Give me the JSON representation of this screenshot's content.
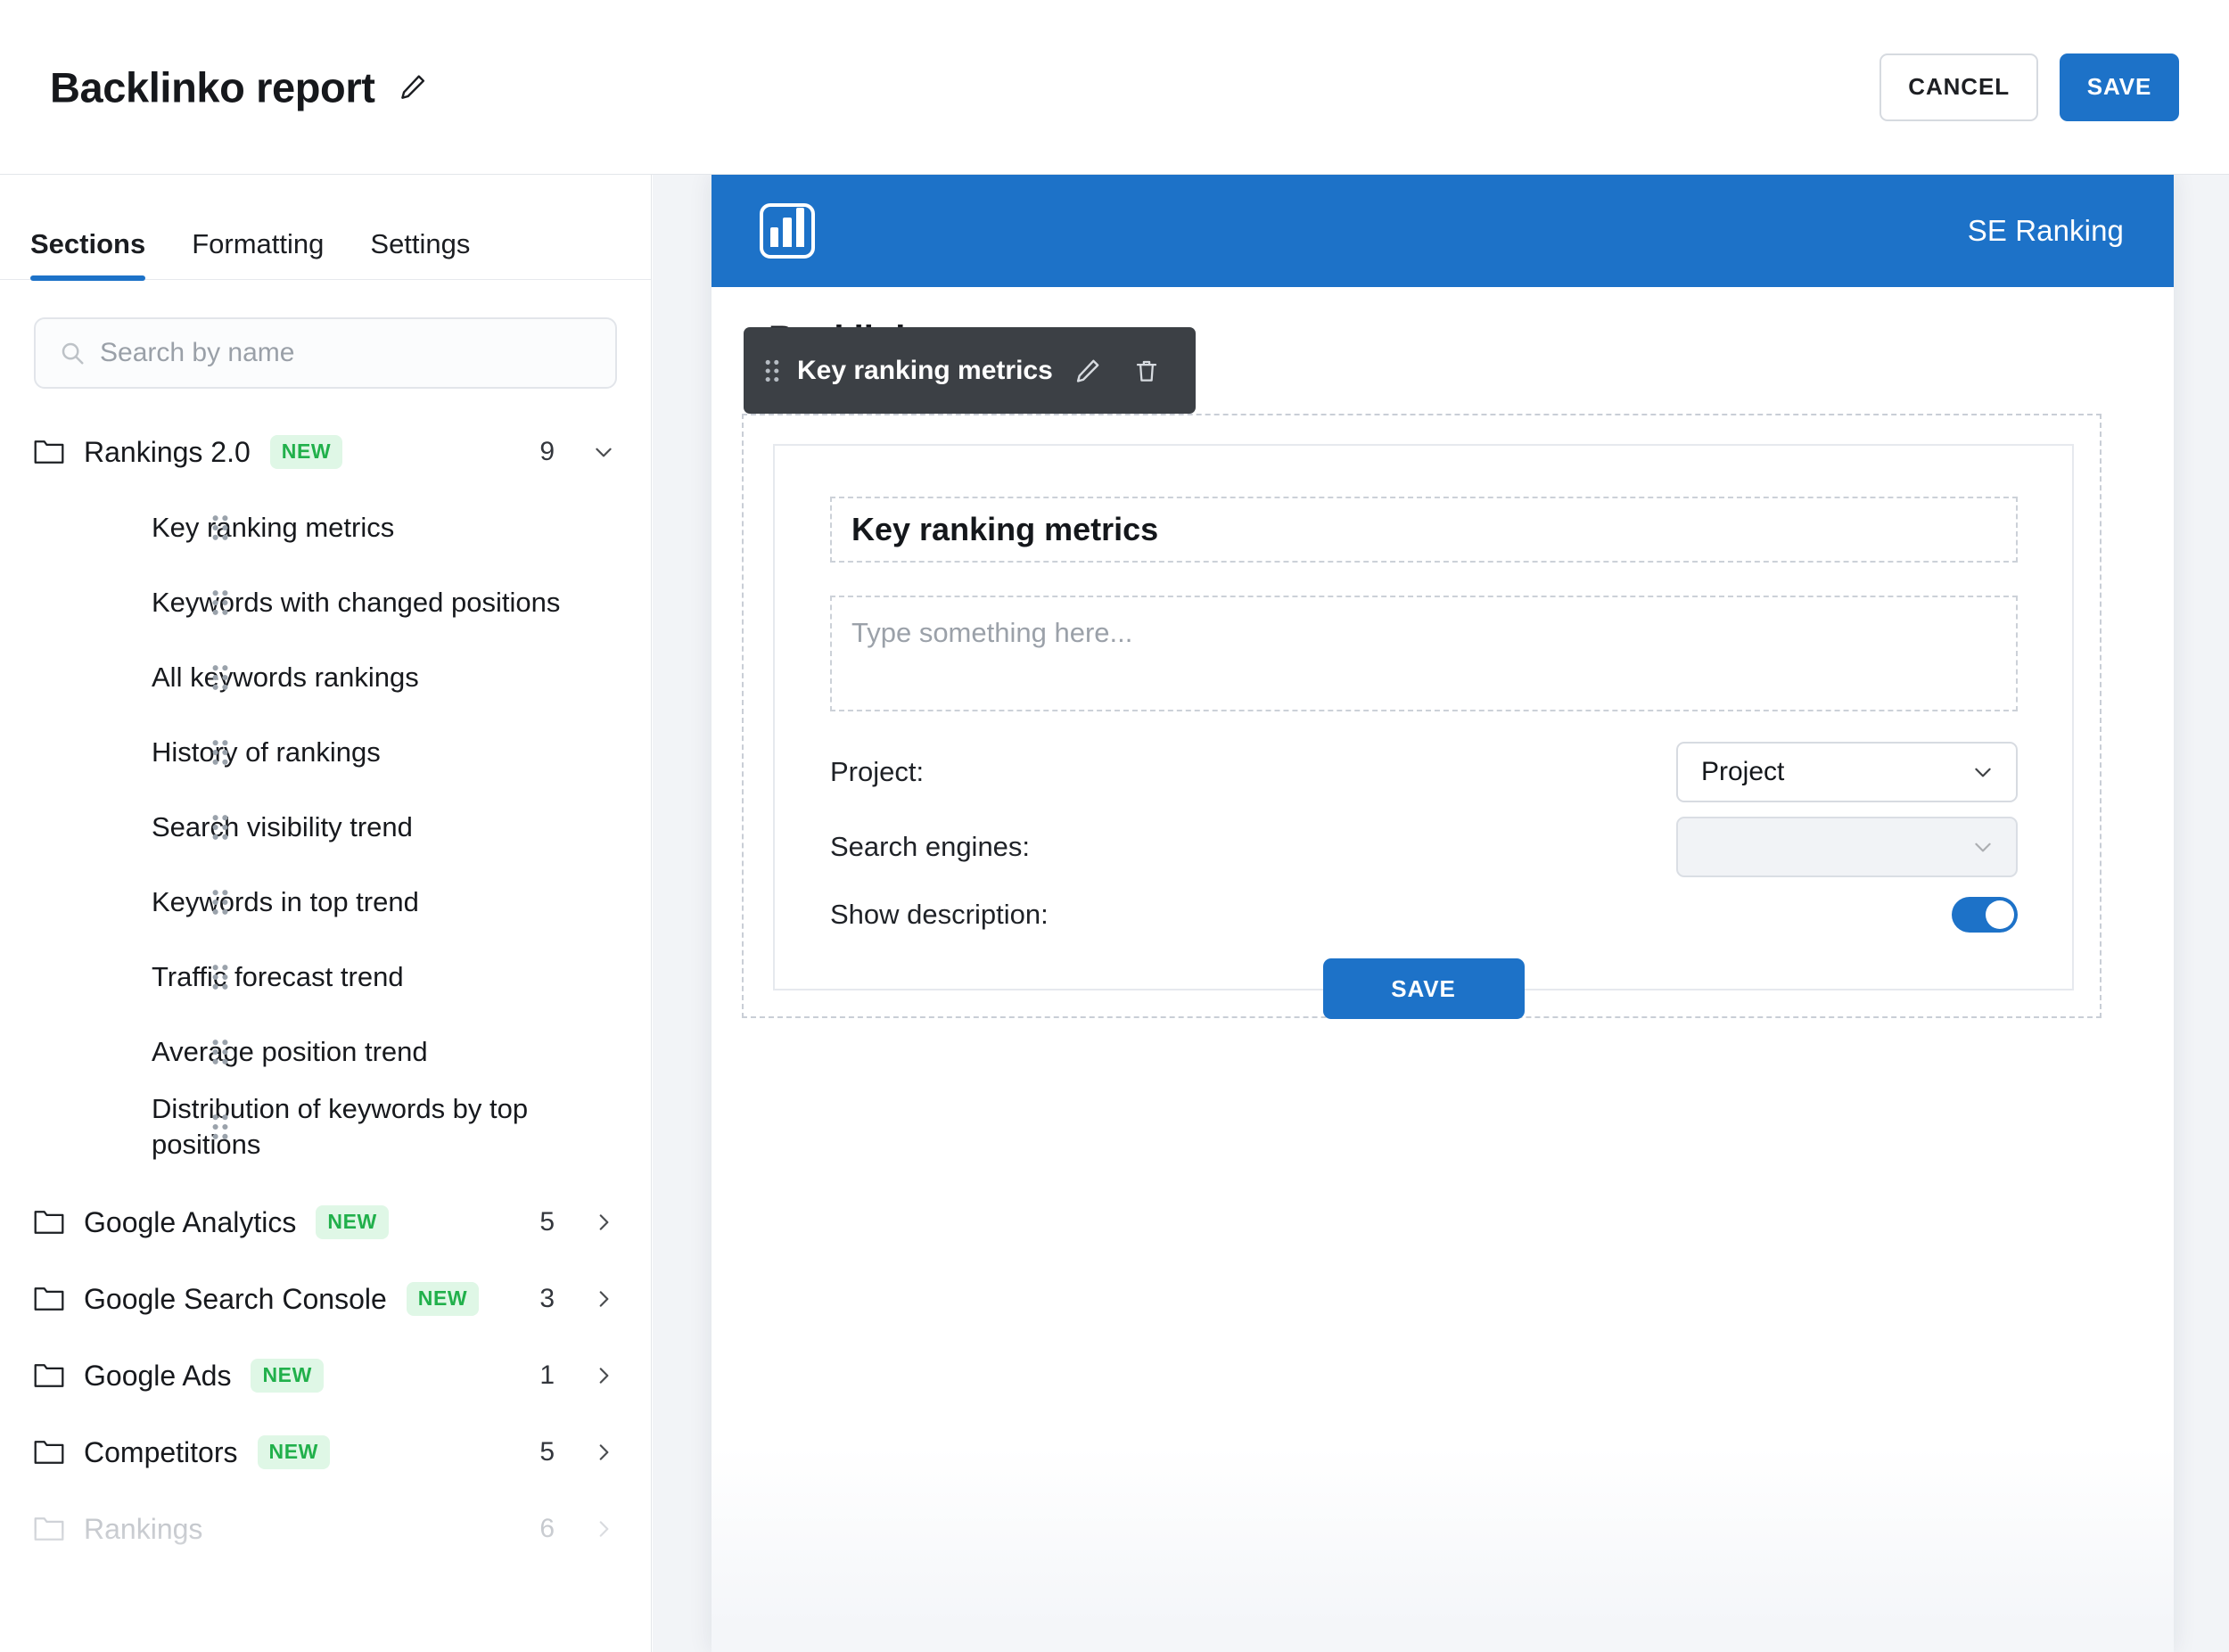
{
  "topbar": {
    "title": "Backlinko report",
    "edit_icon": "pencil-icon",
    "cancel_label": "CANCEL",
    "save_label": "SAVE"
  },
  "sidebar": {
    "tabs": [
      {
        "label": "Sections",
        "active": true
      },
      {
        "label": "Formatting",
        "active": false
      },
      {
        "label": "Settings",
        "active": false
      }
    ],
    "search": {
      "placeholder": "Search by name",
      "value": "",
      "icon": "search-icon"
    },
    "tree": [
      {
        "type": "folder",
        "name": "Rankings 2.0",
        "badge": "NEW",
        "count": "9",
        "expanded": true,
        "chevron": "chevron-down-icon",
        "children": [
          "Key ranking metrics",
          "Keywords with changed positions",
          "All keywords rankings",
          "History of rankings",
          "Search visibility trend",
          "Keywords in top trend",
          "Traffic forecast trend",
          "Average position trend",
          "Distribution of keywords by top positions"
        ]
      },
      {
        "type": "folder",
        "name": "Google Analytics",
        "badge": "NEW",
        "count": "5",
        "expanded": false,
        "chevron": "chevron-right-icon",
        "children": []
      },
      {
        "type": "folder",
        "name": "Google Search Console",
        "badge": "NEW",
        "count": "3",
        "expanded": false,
        "chevron": "chevron-right-icon",
        "children": []
      },
      {
        "type": "folder",
        "name": "Google Ads",
        "badge": "NEW",
        "count": "1",
        "expanded": false,
        "chevron": "chevron-right-icon",
        "children": []
      },
      {
        "type": "folder",
        "name": "Competitors",
        "badge": "NEW",
        "count": "5",
        "expanded": false,
        "chevron": "chevron-right-icon",
        "children": []
      },
      {
        "type": "folder",
        "name": "Rankings",
        "badge": "",
        "count": "6",
        "expanded": false,
        "chevron": "chevron-right-icon",
        "children": []
      }
    ]
  },
  "preview": {
    "doc_header": {
      "logo": "bar-chart-logo-icon",
      "brand": "SE Ranking"
    },
    "headline": "Backlinko report",
    "block_toolbar": {
      "drag_icon": "drag-handle-icon",
      "title": "Key ranking metrics",
      "edit_icon": "pencil-icon",
      "delete_icon": "trash-icon"
    },
    "widget": {
      "title": "Key ranking metrics",
      "description_placeholder": "Type something here...",
      "fields": [
        {
          "label": "Project:",
          "value": "Project",
          "type": "select",
          "disabled": false
        },
        {
          "label": "Search engines:",
          "value": "",
          "type": "select",
          "disabled": true
        }
      ],
      "toggle": {
        "label": "Show description:",
        "on": true
      },
      "save_label": "SAVE"
    }
  },
  "colors": {
    "accent_blue": "#1d72c8",
    "badge_green_text": "#21b04b",
    "badge_green_bg": "#dff7e6",
    "toolbar_dark": "#3c4045",
    "panel_bg": "#f2f4f7"
  }
}
